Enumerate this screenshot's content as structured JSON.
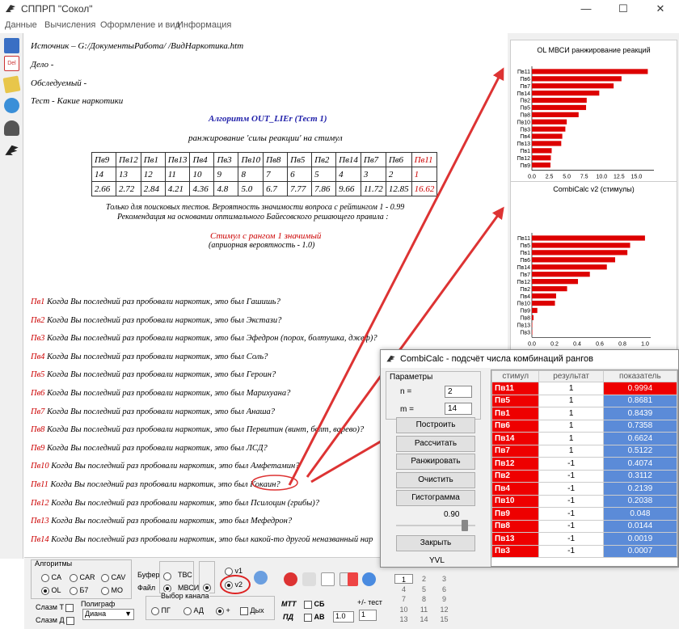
{
  "window": {
    "title": "СППРП \"Сокол\"",
    "minimize": "—",
    "maximize": "☐",
    "close": "✕"
  },
  "menu": [
    "Данные",
    "Вычисления",
    "Оформление и вид",
    "Информация"
  ],
  "document": {
    "source": "Источник – G:/ДокументыРабота/               /ВидНаркотика.htm",
    "case": "Дело -",
    "subject": "Обследуемый -",
    "test": "Тест - Какие наркотики",
    "algorithm": "Алгоритм OUT_LIEr (Тест 1)",
    "ranking": "ранжирование 'силы реакции' на стимул",
    "table": {
      "headers": [
        "Пв9",
        "Пв12",
        "Пв1",
        "Пв13",
        "Пв4",
        "Пв3",
        "Пв10",
        "Пв8",
        "Пв5",
        "Пв2",
        "Пв14",
        "Пв7",
        "Пв6",
        "Пв11"
      ],
      "ranks": [
        "14",
        "13",
        "12",
        "11",
        "10",
        "9",
        "8",
        "7",
        "6",
        "5",
        "4",
        "3",
        "2",
        "1"
      ],
      "values": [
        "2.66",
        "2.72",
        "2.84",
        "4.21",
        "4.36",
        "4.8",
        "5.0",
        "6.7",
        "7.77",
        "7.86",
        "9.66",
        "11.72",
        "12.85",
        "16.62"
      ]
    },
    "note1": "Только для поисковых тестов. Вероятность значимости вопроса с рейтингом 1 - 0.99",
    "note2": "Рекомендация на основании оптимального Байесовского решающего правила :",
    "result": "Стимул с рангом 1 значимый",
    "apriori": "(априорная вероятность - 1.0)",
    "questions": [
      {
        "id": "Пв1",
        "text": " Когда Вы последний раз пробовали наркотик, это был Гашишь?"
      },
      {
        "id": "Пв2",
        "text": " Когда Вы последний раз пробовали наркотик, это был  Экстази?"
      },
      {
        "id": "Пв3",
        "text": " Когда Вы последний раз пробовали наркотик, это был  Эфедрон (порох, болтушка, джеф)?"
      },
      {
        "id": "Пв4",
        "text": " Когда Вы последний раз пробовали наркотик, это был Соль?"
      },
      {
        "id": "Пв5",
        "text": " Когда Вы последний раз пробовали наркотик, это был Героин?"
      },
      {
        "id": "Пв6",
        "text": " Когда Вы последний раз пробовали наркотик, это был   Марихуана?"
      },
      {
        "id": "Пв7",
        "text": " Когда Вы последний раз пробовали наркотик, это был Анаша?"
      },
      {
        "id": "Пв8",
        "text": " Когда Вы последний раз пробовали наркотик, это был Первитин (винт, болт, варево)?"
      },
      {
        "id": "Пв9",
        "text": " Когда Вы последний раз пробовали наркотик, это был ЛСД?"
      },
      {
        "id": "Пв10",
        "text": " Когда Вы последний раз пробовали наркотик, это был  Амфетамин?"
      },
      {
        "id": "Пв11",
        "text": " Когда Вы последний раз пробовали наркотик, это был  Кокаин?"
      },
      {
        "id": "Пв12",
        "text": " Когда Вы последний раз пробовали наркотик, это был  Псилоцин (грибы)?"
      },
      {
        "id": "Пв13",
        "text": " Когда Вы последний раз пробовали наркотик, это был  Мефедрон?"
      },
      {
        "id": "Пв14",
        "text": " Когда Вы последний раз пробовали наркотик, это был какой-то другой неназванный нар"
      }
    ]
  },
  "chart_data": [
    {
      "type": "bar",
      "title": "OL МВСИ ранжирование реакций",
      "orientation": "horizontal",
      "color": "#dd0000",
      "categories": [
        "Пв11",
        "Пв6",
        "Пв7",
        "Пв14",
        "Пв2",
        "Пв5",
        "Пв8",
        "Пв10",
        "Пв3",
        "Пв4",
        "Пв13",
        "Пв1",
        "Пв12",
        "Пв9"
      ],
      "values": [
        16.62,
        12.85,
        11.72,
        9.66,
        7.86,
        7.77,
        6.7,
        5.0,
        4.8,
        4.36,
        4.21,
        2.84,
        2.72,
        2.66
      ],
      "xlim": [
        0,
        17.5
      ],
      "xticks": [
        "0.0",
        "2.5",
        "5.0",
        "7.5",
        "10.0",
        "12.5",
        "15.0"
      ]
    },
    {
      "type": "bar",
      "title": "CombiCalc v2 (стимулы)",
      "orientation": "horizontal",
      "color": "#dd0000",
      "categories": [
        "Пв11",
        "Пв5",
        "Пв1",
        "Пв6",
        "Пв14",
        "Пв7",
        "Пв12",
        "Пв2",
        "Пв4",
        "Пв10",
        "Пв9",
        "Пв8",
        "Пв13",
        "Пв3"
      ],
      "values": [
        0.9994,
        0.8681,
        0.8439,
        0.7358,
        0.6624,
        0.5122,
        0.4074,
        0.3112,
        0.2139,
        0.2038,
        0.048,
        0.0144,
        0.0019,
        0.0007
      ],
      "xlim": [
        0,
        1.05
      ],
      "xticks": [
        "0.0",
        "0.2",
        "0.4",
        "0.6",
        "0.8",
        "1.0"
      ]
    }
  ],
  "dialog": {
    "title": "CombiCalc - подсчёт числа комбинаций рангов",
    "params_label": "Параметры",
    "n_label": "n =",
    "n_value": "2",
    "m_label": "m =",
    "m_value": "14",
    "buttons": [
      "Построить",
      "Рассчитать",
      "Ранжировать",
      "Очистить",
      "Гистограмма"
    ],
    "slider_value": "0.90",
    "slider_level": 0.9,
    "close_button": "Закрыть",
    "footer": "YVL",
    "columns": [
      "стимул",
      "результат",
      "показатель"
    ],
    "rows": [
      {
        "stim": "Пв11",
        "res": "1",
        "val": "0.9994",
        "sel": true
      },
      {
        "stim": "Пв5",
        "res": "1",
        "val": "0.8681"
      },
      {
        "stim": "Пв1",
        "res": "1",
        "val": "0.8439"
      },
      {
        "stim": "Пв6",
        "res": "1",
        "val": "0.7358"
      },
      {
        "stim": "Пв14",
        "res": "1",
        "val": "0.6624"
      },
      {
        "stim": "Пв7",
        "res": "1",
        "val": "0.5122"
      },
      {
        "stim": "Пв12",
        "res": "-1",
        "val": "0.4074"
      },
      {
        "stim": "Пв2",
        "res": "-1",
        "val": "0.3112"
      },
      {
        "stim": "Пв4",
        "res": "-1",
        "val": "0.2139"
      },
      {
        "stim": "Пв10",
        "res": "-1",
        "val": "0.2038"
      },
      {
        "stim": "Пв9",
        "res": "-1",
        "val": "0.048"
      },
      {
        "stim": "Пв8",
        "res": "-1",
        "val": "0.0144"
      },
      {
        "stim": "Пв13",
        "res": "-1",
        "val": "0.0019"
      },
      {
        "stim": "Пв3",
        "res": "-1",
        "val": "0.0007"
      }
    ]
  },
  "bottom": {
    "algorithms_label": "Алгоритмы",
    "alg": [
      "CA",
      "CAR",
      "CAV",
      "OL",
      "Б7",
      "МО"
    ],
    "buffer": "Буфер",
    "file": "Файл",
    "tvs": "ТВС",
    "mvsi": "МВСИ",
    "v1": "v1",
    "v2": "v2",
    "slazm_t": "Слазм Т",
    "slazm_d": "Слазм Д",
    "polygraph_label": "Полиграф",
    "polygraph_value": "Диана",
    "channel_label": "Выбор канала",
    "channels": [
      "ПГ",
      "АД",
      "+",
      "Дых"
    ],
    "mtt": "МТТ",
    "pd": "ПД",
    "sb": "СБ",
    "av": "AB",
    "av_value": "1.0",
    "test_label": "+/- тест",
    "test_value": "1",
    "numgrid": [
      "1",
      "2",
      "3",
      "4",
      "5",
      "6",
      "7",
      "8",
      "9",
      "10",
      "11",
      "12",
      "13",
      "14",
      "15"
    ]
  }
}
